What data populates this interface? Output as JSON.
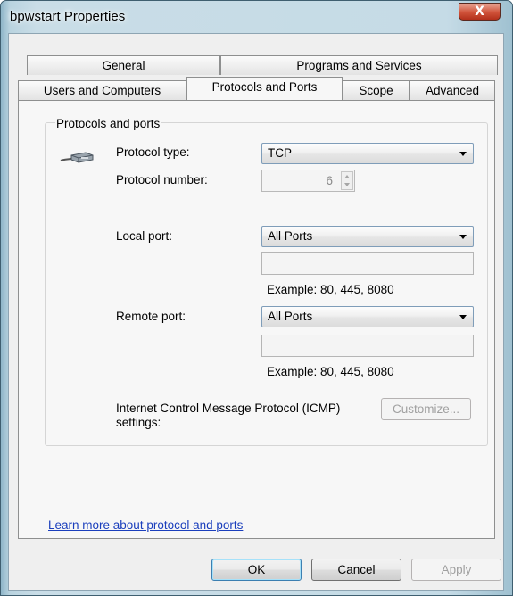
{
  "window": {
    "title": "bpwstart Properties",
    "close_label": "X"
  },
  "tabs": {
    "row1": [
      {
        "label": "General"
      },
      {
        "label": "Programs and Services"
      }
    ],
    "row2": [
      {
        "label": "Users and Computers"
      },
      {
        "label": "Protocols and Ports"
      },
      {
        "label": "Scope"
      },
      {
        "label": "Advanced"
      }
    ],
    "active": "Protocols and Ports"
  },
  "group": {
    "title": "Protocols and ports",
    "icon": "network-cable-icon",
    "protocol_type_label": "Protocol type:",
    "protocol_type_value": "TCP",
    "protocol_number_label": "Protocol number:",
    "protocol_number_value": "6",
    "local_port_label": "Local port:",
    "local_port_value": "All Ports",
    "local_port_text": "",
    "local_port_example": "Example: 80, 445, 8080",
    "remote_port_label": "Remote port:",
    "remote_port_value": "All Ports",
    "remote_port_text": "",
    "remote_port_example": "Example: 80, 445, 8080",
    "icmp_label": "Internet Control Message Protocol (ICMP) settings:",
    "customize_label": "Customize..."
  },
  "link": "Learn more about protocol and ports",
  "buttons": {
    "ok": "OK",
    "cancel": "Cancel",
    "apply": "Apply"
  }
}
